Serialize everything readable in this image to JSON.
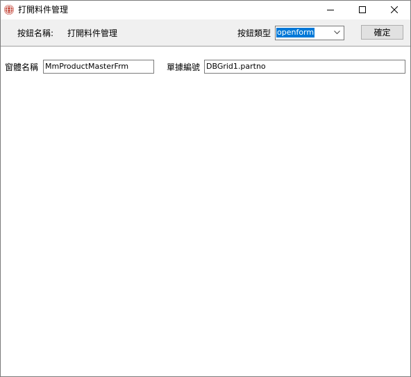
{
  "window": {
    "title": "打開料件管理",
    "controls": {
      "minimize_icon": "minimize-icon",
      "maximize_icon": "maximize-icon",
      "close_icon": "close-icon"
    }
  },
  "toolbar": {
    "button_name_label": "按鈕名稱:",
    "button_name_value": "打開料件管理",
    "button_type_label": "按鈕類型",
    "button_type_value": "openform",
    "confirm_label": "確定"
  },
  "form": {
    "window_name_label": "窗體名稱",
    "window_name_value": "MmProductMasterFrm",
    "doc_number_label": "單據編號",
    "doc_number_value": "DBGrid1.partno"
  },
  "colors": {
    "selection": "#0078d7",
    "toolbar_bg": "#f0f0f0",
    "app_icon": "#c0392b"
  }
}
